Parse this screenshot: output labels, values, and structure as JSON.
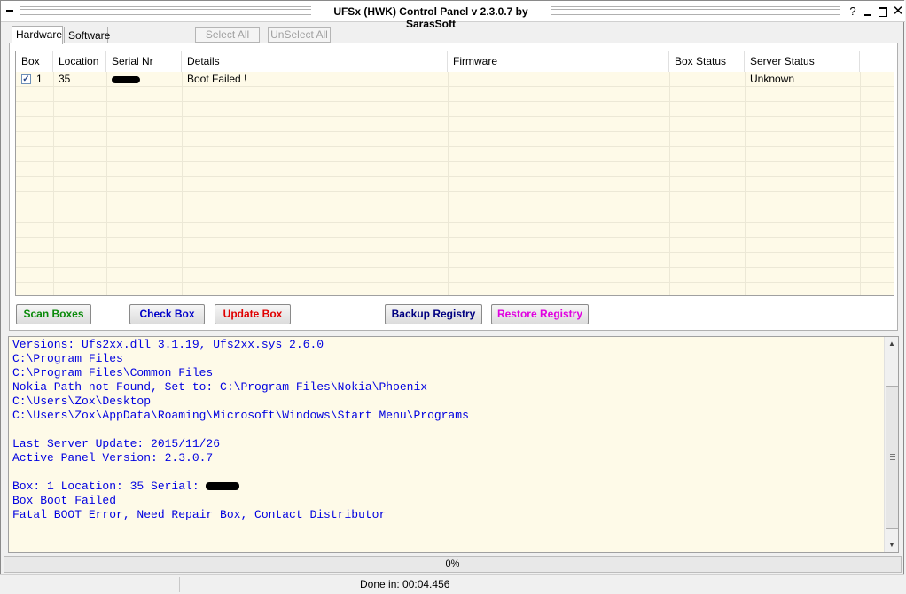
{
  "window": {
    "title": "UFSx (HWK) Control Panel v 2.3.0.7 by SarasSoft",
    "help_glyph": "?",
    "close_glyph": "✕"
  },
  "tabs": [
    {
      "label": "Hardware",
      "active": true
    },
    {
      "label": "Software",
      "active": false
    }
  ],
  "toolbar": {
    "select_all": "Select All",
    "unselect_all": "UnSelect All"
  },
  "grid": {
    "columns": [
      "Box",
      "Location",
      "Serial Nr",
      "Details",
      "Firmware",
      "Box Status",
      "Server Status"
    ],
    "rows": [
      {
        "checked": true,
        "box": "1",
        "location": "35",
        "serial": "",
        "details": "Boot Failed !",
        "firmware": "",
        "box_status": "",
        "server_status": "Unknown"
      }
    ],
    "checkmark": "✓",
    "colors": {
      "row_background": "#fefae8"
    }
  },
  "actions": {
    "scan_boxes": "Scan Boxes",
    "check_box": "Check Box",
    "update_box": "Update Box",
    "backup_registry": "Backup Registry",
    "restore_registry": "Restore Registry",
    "colors": {
      "scan": "#0a8a0a",
      "check": "#0000c8",
      "update": "#e00000",
      "backup": "#000080",
      "restore": "#e000e0"
    }
  },
  "log": {
    "lines": [
      "Versions: Ufs2xx.dll 3.1.19, Ufs2xx.sys 2.6.0",
      "C:\\Program Files",
      "C:\\Program Files\\Common Files",
      "Nokia Path not Found, Set to: C:\\Program Files\\Nokia\\Phoenix",
      "C:\\Users\\Zox\\Desktop",
      "C:\\Users\\Zox\\AppData\\Roaming\\Microsoft\\Windows\\Start Menu\\Programs",
      "",
      "Last Server Update: 2015/11/26",
      "Active Panel Version: 2.3.0.7",
      "",
      "Box: 1 Location: 35 Serial: ",
      "Box Boot Failed",
      "Fatal BOOT Error, Need Repair Box, Contact Distributor"
    ],
    "color": "#0000e0",
    "scroll_up_glyph": "▲",
    "scroll_down_glyph": "▼"
  },
  "progress": {
    "value": 0,
    "label": "0%"
  },
  "status": {
    "text": "Done in: 00:04.456"
  }
}
